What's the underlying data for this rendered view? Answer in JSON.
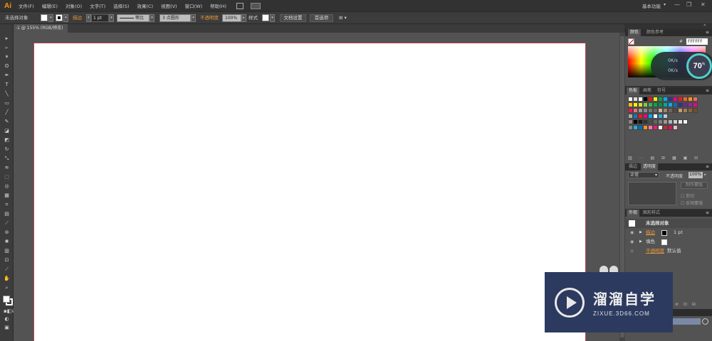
{
  "app": {
    "logo": "Ai"
  },
  "menu": [
    "文件(F)",
    "编辑(E)",
    "对象(O)",
    "文字(T)",
    "选择(S)",
    "效果(C)",
    "视图(V)",
    "窗口(W)",
    "帮助(H)"
  ],
  "workspace": {
    "label": "基本功能",
    "arrow": "▾"
  },
  "window_controls": [
    "—",
    "❐",
    "✕"
  ],
  "control": {
    "selection": "未选择对象",
    "stroke_label": "描边",
    "stroke_weight": "1 pt",
    "stroke_profile": "等比",
    "brush": "3 点圆形",
    "opacity_label": "不透明度",
    "opacity_value": "100%",
    "style_label": "样式",
    "doc_setup": "文档设置",
    "preferences": "首选项"
  },
  "document_tab": {
    "label": "-1 @ 155% (RGB/预览)"
  },
  "panels": {
    "color": {
      "tabs": [
        "颜色",
        "颜色参考"
      ],
      "hex": "FFFFFF",
      "hex_prefix": "#"
    },
    "net_widget": {
      "up": "0K/s",
      "down": "0K/s",
      "percent": "70",
      "percent_unit": "%"
    },
    "swatches": {
      "tabs": [
        "色板",
        "画笔",
        "符号"
      ]
    },
    "transparency": {
      "tabs": [
        "描边",
        "透明度"
      ],
      "blend_mode": "正常",
      "opacity_label": "不透明度",
      "opacity_value": "100%",
      "make_mask": "制作蒙版",
      "clip": "剪切",
      "invert_mask": "反相蒙版"
    },
    "appearance": {
      "tabs": [
        "外观",
        "图形样式"
      ],
      "title": "未选择对象",
      "rows": [
        {
          "label": "描边",
          "value": "1 pt",
          "label_color": "#e8963a"
        },
        {
          "label": "填色",
          "value": "",
          "label_color": "#dddddd"
        },
        {
          "label": "不透明度",
          "value": "默认值",
          "label_color": "#e8963a"
        }
      ]
    }
  },
  "watermark": {
    "title": "溜溜自学",
    "url": "ZIXUE.3D66.COM"
  },
  "colors": {
    "accent": "#ff9a00",
    "artboard_border": "#b5434a",
    "canvas": "#535353",
    "watermark_bg": "#2c3a5f"
  }
}
